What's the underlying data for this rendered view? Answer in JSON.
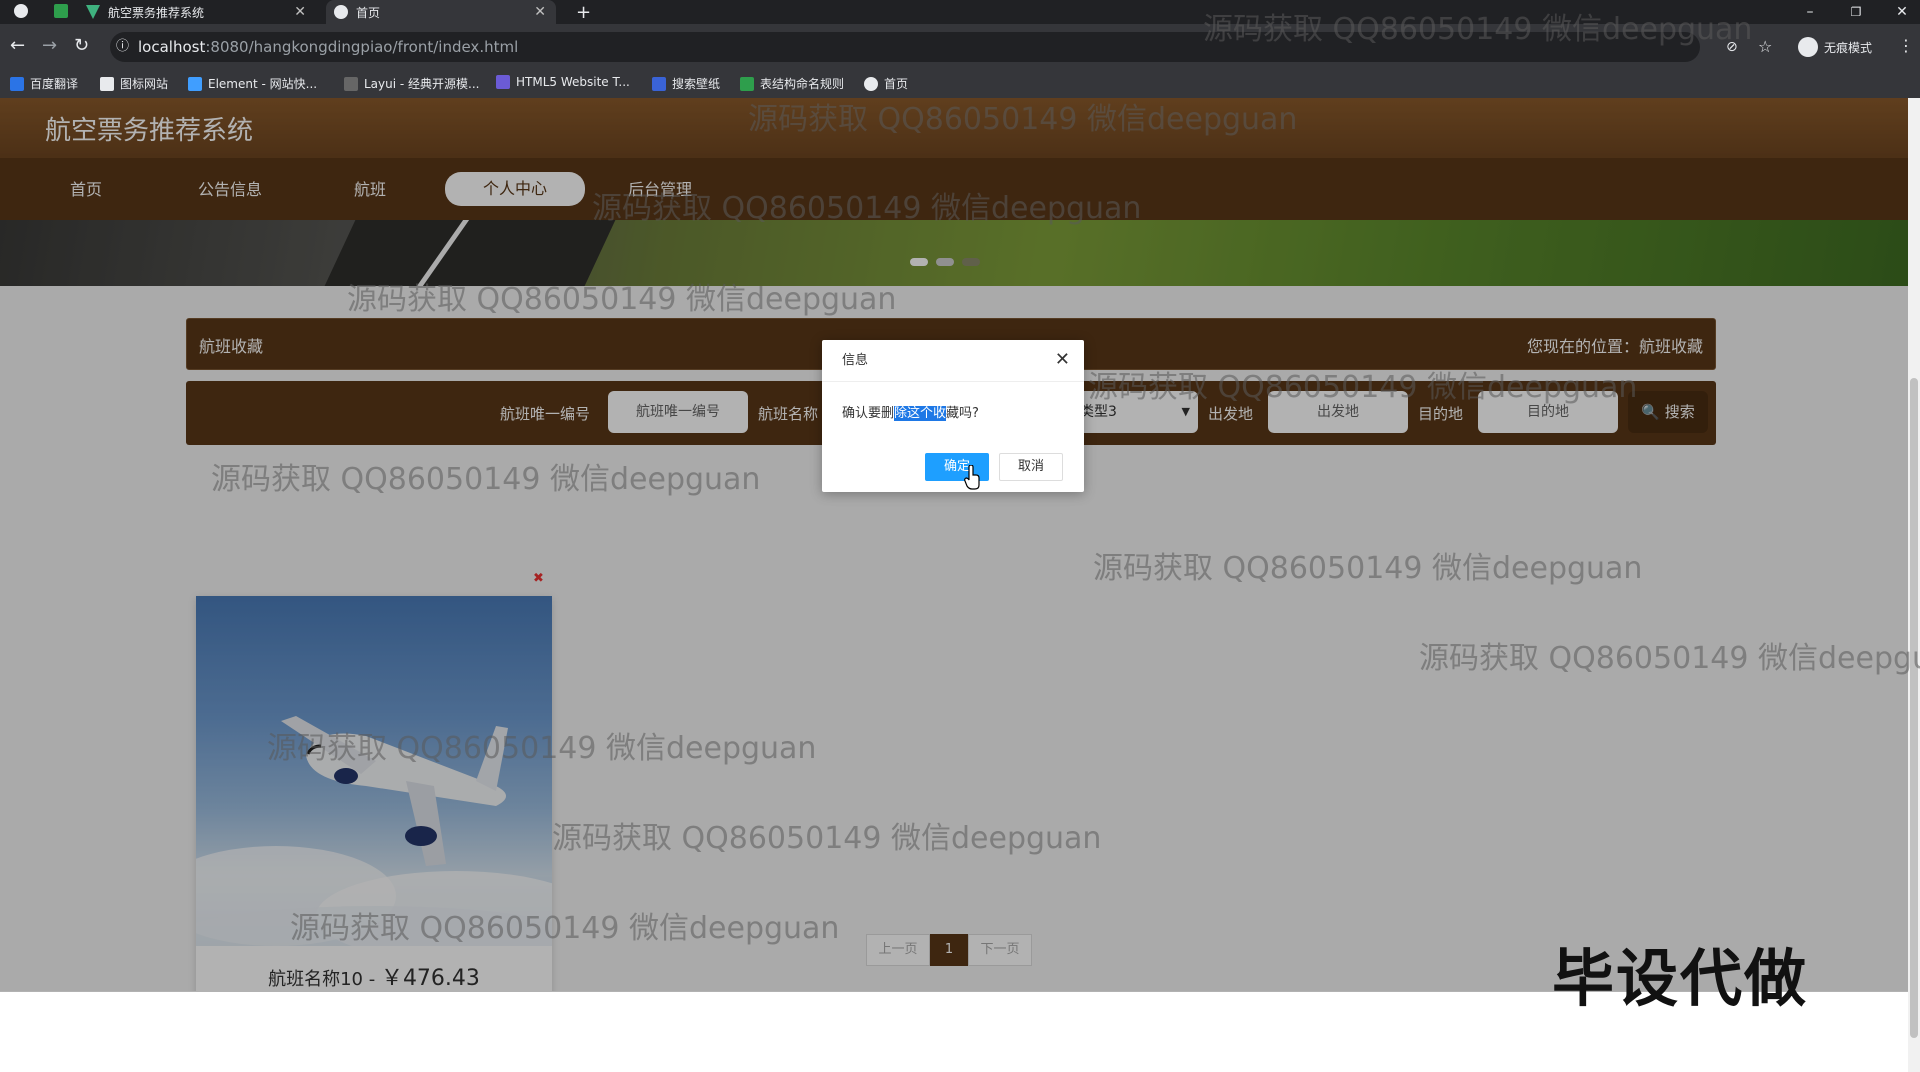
{
  "browser": {
    "tabs": [
      {
        "title": "航空票务推荐系统"
      },
      {
        "title": "首页"
      }
    ],
    "new_tab": "+",
    "window_controls": {
      "minimize": "–",
      "restore": "❐",
      "close": "✕"
    },
    "url_host": "localhost",
    "url_path": ":8080/hangkongdingpiao/front/index.html",
    "profile_label": "无痕模式",
    "bookmarks": [
      "百度翻译",
      "图标网站",
      "Element - 网站快...",
      "Layui - 经典开源模...",
      "HTML5 Website T...",
      "搜索壁纸",
      "表结构命名规则",
      "首页"
    ]
  },
  "site": {
    "title": "航空票务推荐系统",
    "nav": [
      "首页",
      "公告信息",
      "航班",
      "个人中心",
      "后台管理"
    ],
    "active_nav": "个人中心"
  },
  "breadcrumb": {
    "title": "航班收藏",
    "location": "您现在的位置：航班收藏"
  },
  "search": {
    "label1": "航班唯一编号",
    "placeholder1": "航班唯一编号",
    "label2": "航班名称",
    "select_value": "航班类型3",
    "label3": "出发地",
    "placeholder3": "出发地",
    "label4": "目的地",
    "placeholder4": "目的地",
    "button": "搜索"
  },
  "card": {
    "name": "航班名称10",
    "sep": " - ",
    "price": "￥476.43"
  },
  "pager": {
    "prev": "上一页",
    "current": "1",
    "next": "下一页"
  },
  "dialog": {
    "title": "信息",
    "message_pre": "确认要删",
    "message_hl": "除这个收",
    "message_post": "藏吗?",
    "ok": "确定",
    "cancel": "取消",
    "close": "✕"
  },
  "watermark": "源码获取 QQ86050149 微信deepguan",
  "watermark_cut": "源码获取 QQ86050149 微信deepgu",
  "corner_badge": "毕设代做",
  "colors": {
    "brand_brown": "#5a3717",
    "ok_blue": "#1e9fff",
    "highlight": "#1e78e6"
  }
}
